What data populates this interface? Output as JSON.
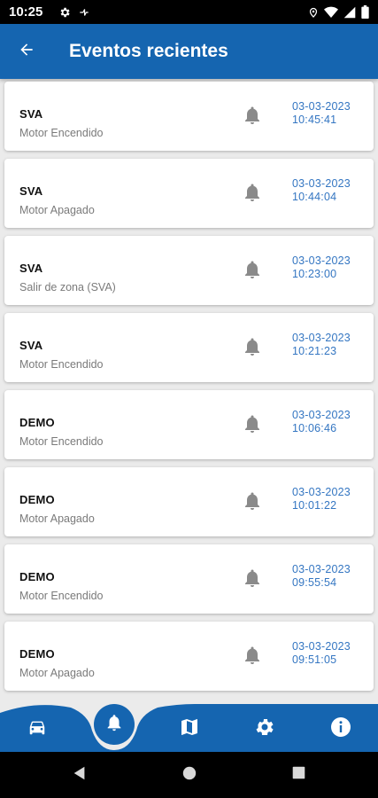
{
  "status_bar": {
    "time": "10:25"
  },
  "app_bar": {
    "title": "Eventos recientes"
  },
  "events": [
    {
      "name": "SVA",
      "description": "Motor Encendido",
      "date": "03-03-2023",
      "time": "10:45:41"
    },
    {
      "name": "SVA",
      "description": "Motor Apagado",
      "date": "03-03-2023",
      "time": "10:44:04"
    },
    {
      "name": "SVA",
      "description": "Salir de zona (SVA)",
      "date": "03-03-2023",
      "time": "10:23:00"
    },
    {
      "name": "SVA",
      "description": "Motor Encendido",
      "date": "03-03-2023",
      "time": "10:21:23"
    },
    {
      "name": "DEMO",
      "description": "Motor Encendido",
      "date": "03-03-2023",
      "time": "10:06:46"
    },
    {
      "name": "DEMO",
      "description": "Motor Apagado",
      "date": "03-03-2023",
      "time": "10:01:22"
    },
    {
      "name": "DEMO",
      "description": "Motor Encendido",
      "date": "03-03-2023",
      "time": "09:55:54"
    },
    {
      "name": "DEMO",
      "description": "Motor Apagado",
      "date": "03-03-2023",
      "time": "09:51:05"
    }
  ],
  "bottom_nav": {
    "items": [
      {
        "icon": "car-icon"
      },
      {
        "icon": "bell-icon",
        "active": true
      },
      {
        "icon": "map-icon"
      },
      {
        "icon": "gear-icon"
      },
      {
        "icon": "info-icon"
      }
    ]
  },
  "colors": {
    "primary": "#1565b0",
    "date_text": "#3476c2",
    "bell": "#8a8a8a"
  }
}
